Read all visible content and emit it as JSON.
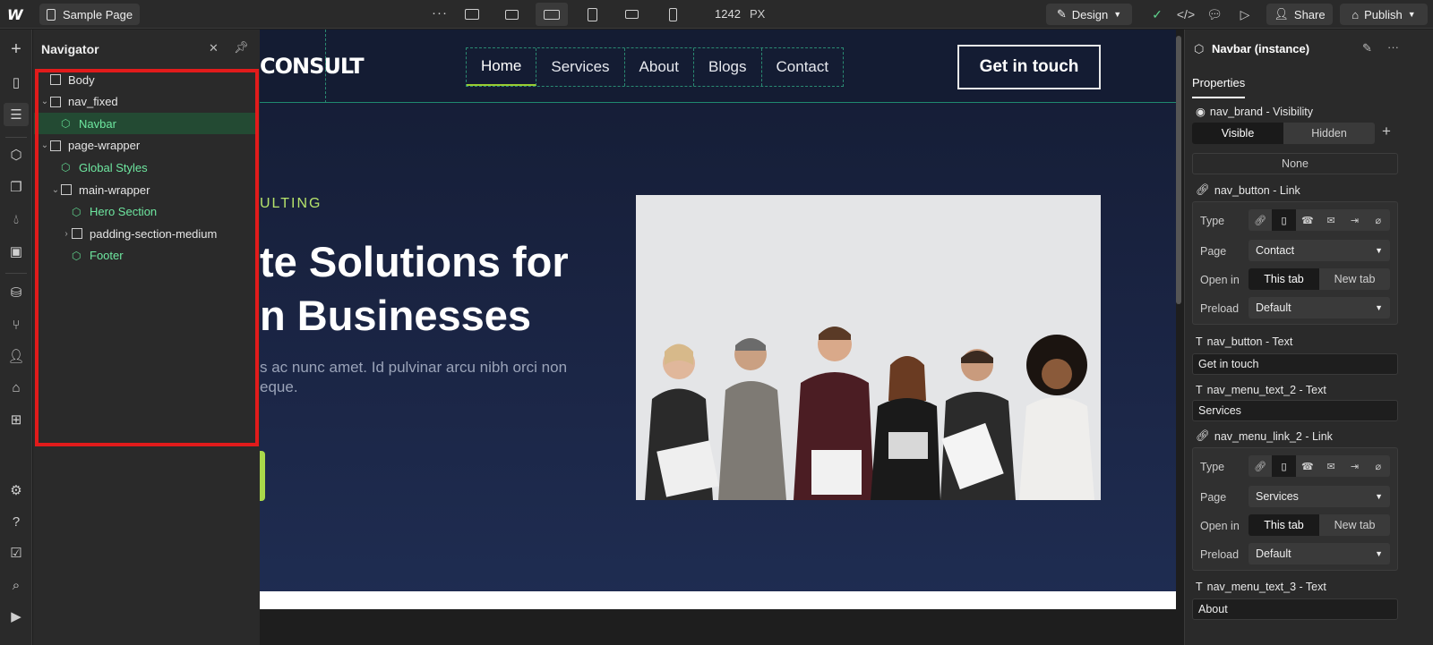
{
  "topbar": {
    "page_name": "Sample Page",
    "more": "···",
    "width_value": "1242",
    "width_unit": "PX",
    "design_label": "Design",
    "share_label": "Share",
    "publish_label": "Publish"
  },
  "navigator": {
    "title": "Navigator",
    "tree": [
      {
        "label": "Body",
        "kind": "element",
        "level": 0,
        "expanded": null,
        "selected": false
      },
      {
        "label": "nav_fixed",
        "kind": "element",
        "level": 0,
        "expanded": true,
        "selected": false
      },
      {
        "label": "Navbar",
        "kind": "component",
        "level": 1,
        "expanded": null,
        "selected": true
      },
      {
        "label": "page-wrapper",
        "kind": "element",
        "level": 0,
        "expanded": true,
        "selected": false
      },
      {
        "label": "Global Styles",
        "kind": "component",
        "level": 1,
        "expanded": null,
        "selected": false
      },
      {
        "label": "main-wrapper",
        "kind": "element",
        "level": 1,
        "expanded": true,
        "selected": false
      },
      {
        "label": "Hero Section",
        "kind": "component",
        "level": 2,
        "expanded": null,
        "selected": false
      },
      {
        "label": "padding-section-medium",
        "kind": "section",
        "level": 2,
        "expanded": false,
        "selected": false
      },
      {
        "label": "Footer",
        "kind": "component",
        "level": 2,
        "expanded": null,
        "selected": false
      }
    ]
  },
  "canvas": {
    "brand": "CONSULT",
    "menu": [
      "Home",
      "Services",
      "About",
      "Blogs",
      "Contact"
    ],
    "cta": "Get in touch",
    "eyebrow": "ULTING",
    "headline_1": "te Solutions for",
    "headline_2": "n Businesses",
    "lede_1": "s ac nunc amet. Id pulvinar arcu nibh orci non",
    "lede_2": "eque."
  },
  "properties": {
    "title": "Navbar (instance)",
    "tab": "Properties",
    "visibility": {
      "label": "nav_brand - Visibility",
      "options": [
        "Visible",
        "Hidden"
      ],
      "selected": "Visible",
      "none": "None"
    },
    "link1": {
      "label": "nav_button - Link",
      "type_label": "Type",
      "page_label": "Page",
      "page_value": "Contact",
      "open_label": "Open in",
      "open_options": [
        "This tab",
        "New tab"
      ],
      "preload_label": "Preload",
      "preload_value": "Default"
    },
    "text1": {
      "label": "nav_button - Text",
      "value": "Get in touch"
    },
    "text2": {
      "label": "nav_menu_text_2 - Text",
      "value": "Services"
    },
    "link2": {
      "label": "nav_menu_link_2 - Link",
      "type_label": "Type",
      "page_label": "Page",
      "page_value": "Services",
      "open_label": "Open in",
      "open_options": [
        "This tab",
        "New tab"
      ],
      "preload_label": "Preload",
      "preload_value": "Default"
    },
    "text3": {
      "label": "nav_menu_text_3 - Text",
      "value": "About"
    }
  }
}
